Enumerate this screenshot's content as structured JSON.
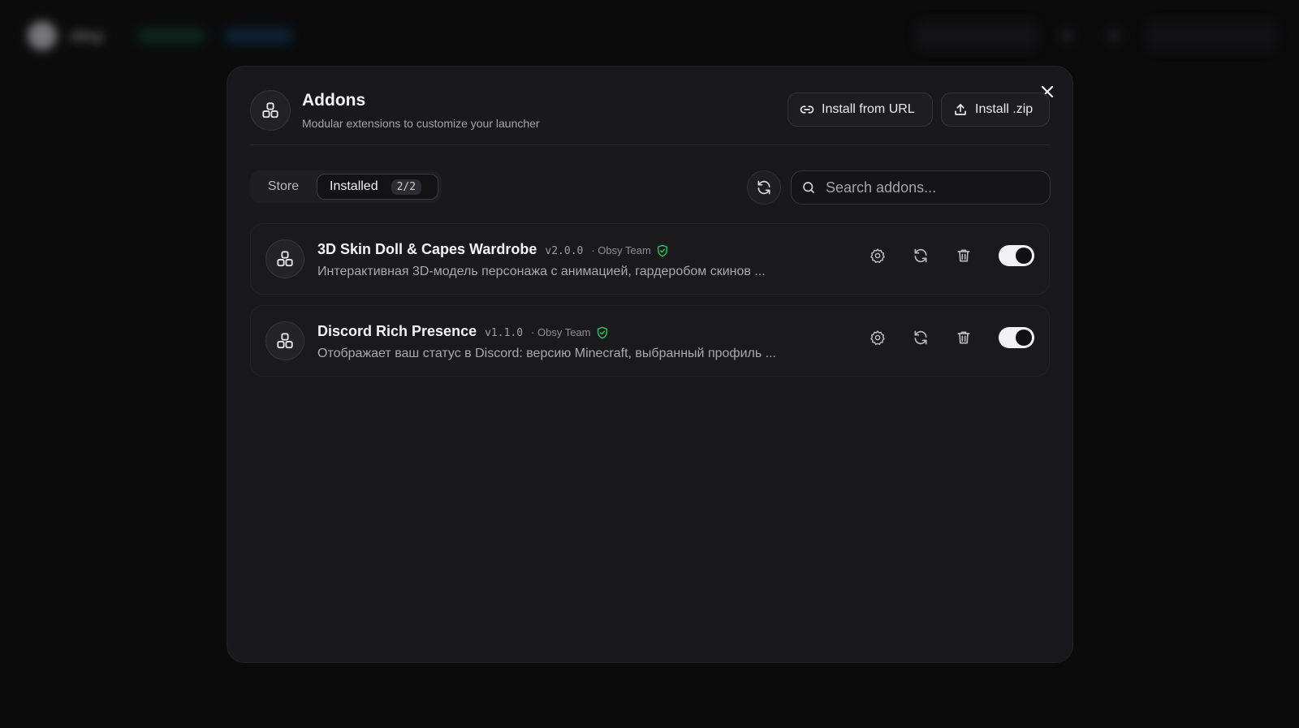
{
  "background": {
    "brand": "obsy"
  },
  "modal": {
    "title": "Addons",
    "subtitle": "Modular extensions to customize your launcher",
    "install_url_label": "Install from URL",
    "install_zip_label": "Install .zip",
    "icon": "addons-icon"
  },
  "tabs": {
    "store_label": "Store",
    "installed_label": "Installed",
    "installed_count": "2/2",
    "active": "Installed"
  },
  "search": {
    "placeholder": "Search addons...",
    "value": ""
  },
  "addons": [
    {
      "name": "3D Skin Doll & Capes Wardrobe",
      "version": "v2.0.0",
      "author": "· Obsy Team",
      "verified": true,
      "description": "Интерактивная 3D-модель персонажа с анимацией, гардеробом скинов ...",
      "enabled": true
    },
    {
      "name": "Discord Rich Presence",
      "version": "v1.1.0",
      "author": "· Obsy Team",
      "verified": true,
      "description": "Отображает ваш статус в Discord: версию Minecraft, выбранный профиль ...",
      "enabled": true
    }
  ],
  "colors": {
    "modal_bg": "#19191b",
    "verified_green": "#22c55e",
    "toggle_on": "#f1f1f3"
  }
}
